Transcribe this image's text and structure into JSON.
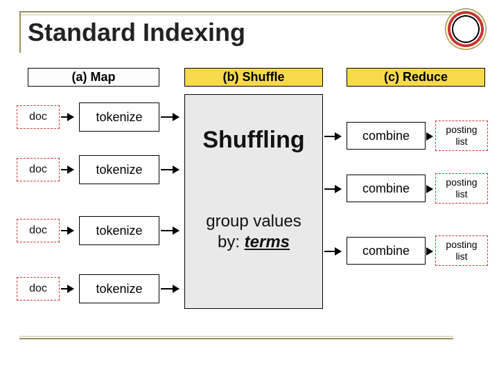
{
  "title": "Standard Indexing",
  "phases": {
    "a": "(a) Map",
    "b": "(b) Shuffle",
    "c": "(c) Reduce"
  },
  "map": {
    "doc_label": "doc",
    "tokenize_label": "tokenize",
    "rows": 4
  },
  "shuffle": {
    "big": "Shuffling",
    "line1": "group values",
    "line2_prefix": "by: ",
    "line2_kw": "terms"
  },
  "reduce": {
    "combine_label": "combine",
    "plist_label": "posting list",
    "rows": 3
  }
}
